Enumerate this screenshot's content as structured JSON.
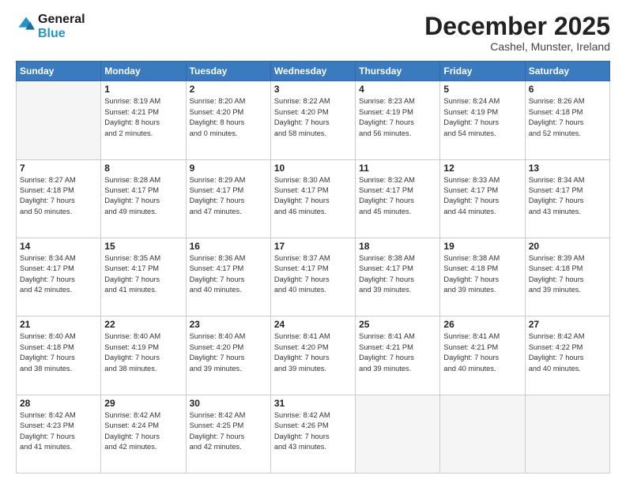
{
  "header": {
    "logo_line1": "General",
    "logo_line2": "Blue",
    "month_title": "December 2025",
    "location": "Cashel, Munster, Ireland"
  },
  "days_of_week": [
    "Sunday",
    "Monday",
    "Tuesday",
    "Wednesday",
    "Thursday",
    "Friday",
    "Saturday"
  ],
  "weeks": [
    [
      {
        "day": "",
        "info": ""
      },
      {
        "day": "1",
        "info": "Sunrise: 8:19 AM\nSunset: 4:21 PM\nDaylight: 8 hours\nand 2 minutes."
      },
      {
        "day": "2",
        "info": "Sunrise: 8:20 AM\nSunset: 4:20 PM\nDaylight: 8 hours\nand 0 minutes."
      },
      {
        "day": "3",
        "info": "Sunrise: 8:22 AM\nSunset: 4:20 PM\nDaylight: 7 hours\nand 58 minutes."
      },
      {
        "day": "4",
        "info": "Sunrise: 8:23 AM\nSunset: 4:19 PM\nDaylight: 7 hours\nand 56 minutes."
      },
      {
        "day": "5",
        "info": "Sunrise: 8:24 AM\nSunset: 4:19 PM\nDaylight: 7 hours\nand 54 minutes."
      },
      {
        "day": "6",
        "info": "Sunrise: 8:26 AM\nSunset: 4:18 PM\nDaylight: 7 hours\nand 52 minutes."
      }
    ],
    [
      {
        "day": "7",
        "info": "Sunrise: 8:27 AM\nSunset: 4:18 PM\nDaylight: 7 hours\nand 50 minutes."
      },
      {
        "day": "8",
        "info": "Sunrise: 8:28 AM\nSunset: 4:17 PM\nDaylight: 7 hours\nand 49 minutes."
      },
      {
        "day": "9",
        "info": "Sunrise: 8:29 AM\nSunset: 4:17 PM\nDaylight: 7 hours\nand 47 minutes."
      },
      {
        "day": "10",
        "info": "Sunrise: 8:30 AM\nSunset: 4:17 PM\nDaylight: 7 hours\nand 46 minutes."
      },
      {
        "day": "11",
        "info": "Sunrise: 8:32 AM\nSunset: 4:17 PM\nDaylight: 7 hours\nand 45 minutes."
      },
      {
        "day": "12",
        "info": "Sunrise: 8:33 AM\nSunset: 4:17 PM\nDaylight: 7 hours\nand 44 minutes."
      },
      {
        "day": "13",
        "info": "Sunrise: 8:34 AM\nSunset: 4:17 PM\nDaylight: 7 hours\nand 43 minutes."
      }
    ],
    [
      {
        "day": "14",
        "info": "Sunrise: 8:34 AM\nSunset: 4:17 PM\nDaylight: 7 hours\nand 42 minutes."
      },
      {
        "day": "15",
        "info": "Sunrise: 8:35 AM\nSunset: 4:17 PM\nDaylight: 7 hours\nand 41 minutes."
      },
      {
        "day": "16",
        "info": "Sunrise: 8:36 AM\nSunset: 4:17 PM\nDaylight: 7 hours\nand 40 minutes."
      },
      {
        "day": "17",
        "info": "Sunrise: 8:37 AM\nSunset: 4:17 PM\nDaylight: 7 hours\nand 40 minutes."
      },
      {
        "day": "18",
        "info": "Sunrise: 8:38 AM\nSunset: 4:17 PM\nDaylight: 7 hours\nand 39 minutes."
      },
      {
        "day": "19",
        "info": "Sunrise: 8:38 AM\nSunset: 4:18 PM\nDaylight: 7 hours\nand 39 minutes."
      },
      {
        "day": "20",
        "info": "Sunrise: 8:39 AM\nSunset: 4:18 PM\nDaylight: 7 hours\nand 39 minutes."
      }
    ],
    [
      {
        "day": "21",
        "info": "Sunrise: 8:40 AM\nSunset: 4:18 PM\nDaylight: 7 hours\nand 38 minutes."
      },
      {
        "day": "22",
        "info": "Sunrise: 8:40 AM\nSunset: 4:19 PM\nDaylight: 7 hours\nand 38 minutes."
      },
      {
        "day": "23",
        "info": "Sunrise: 8:40 AM\nSunset: 4:20 PM\nDaylight: 7 hours\nand 39 minutes."
      },
      {
        "day": "24",
        "info": "Sunrise: 8:41 AM\nSunset: 4:20 PM\nDaylight: 7 hours\nand 39 minutes."
      },
      {
        "day": "25",
        "info": "Sunrise: 8:41 AM\nSunset: 4:21 PM\nDaylight: 7 hours\nand 39 minutes."
      },
      {
        "day": "26",
        "info": "Sunrise: 8:41 AM\nSunset: 4:21 PM\nDaylight: 7 hours\nand 40 minutes."
      },
      {
        "day": "27",
        "info": "Sunrise: 8:42 AM\nSunset: 4:22 PM\nDaylight: 7 hours\nand 40 minutes."
      }
    ],
    [
      {
        "day": "28",
        "info": "Sunrise: 8:42 AM\nSunset: 4:23 PM\nDaylight: 7 hours\nand 41 minutes."
      },
      {
        "day": "29",
        "info": "Sunrise: 8:42 AM\nSunset: 4:24 PM\nDaylight: 7 hours\nand 42 minutes."
      },
      {
        "day": "30",
        "info": "Sunrise: 8:42 AM\nSunset: 4:25 PM\nDaylight: 7 hours\nand 42 minutes."
      },
      {
        "day": "31",
        "info": "Sunrise: 8:42 AM\nSunset: 4:26 PM\nDaylight: 7 hours\nand 43 minutes."
      },
      {
        "day": "",
        "info": ""
      },
      {
        "day": "",
        "info": ""
      },
      {
        "day": "",
        "info": ""
      }
    ]
  ]
}
